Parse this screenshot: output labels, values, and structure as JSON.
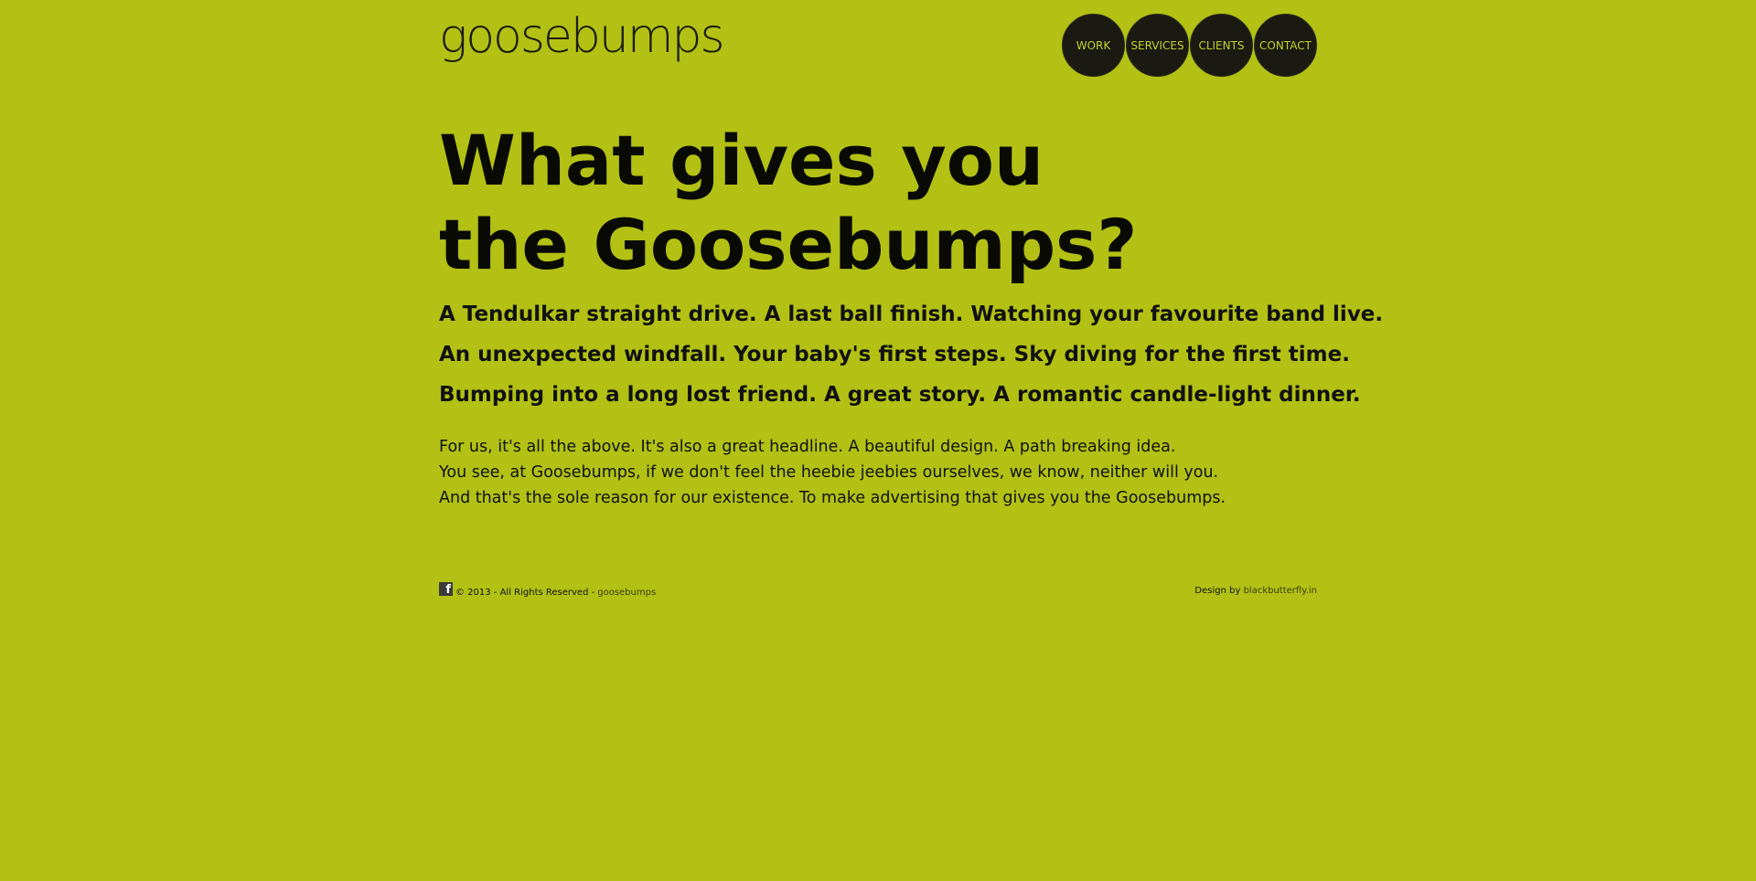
{
  "brand": {
    "logo_text": "goosebumps"
  },
  "nav": {
    "items": [
      {
        "label": "WORK"
      },
      {
        "label": "SERVICES"
      },
      {
        "label": "CLIENTS"
      },
      {
        "label": "CONTACT"
      }
    ]
  },
  "hero": {
    "headline_line1": "What gives you",
    "headline_line2": "the Goosebumps?",
    "sub_lines": [
      "A Tendulkar straight drive. A last ball finish. Watching your favourite band live.",
      "An unexpected windfall. Your baby's first steps. Sky diving for the first time.",
      "Bumping into a long lost friend. A great story. A romantic candle-light dinner."
    ],
    "body_lines": [
      "For us, it's all the above. It's also a great headline. A beautiful design. A path breaking idea.",
      "You see, at Goosebumps, if we don't feel the heebie jeebies ourselves, we know, neither will you.",
      "And that's the sole reason for our existence. To make advertising that gives you the Goosebumps."
    ]
  },
  "footer": {
    "copyright": "© 2013 - All Rights Reserved -",
    "copyright_link": "goosebumps",
    "design_by": "Design by",
    "design_link": "blackbutterfly.in",
    "facebook_icon": "facebook-icon"
  },
  "colors": {
    "background": "#b2c114",
    "nav_circle": "#1b1a12",
    "nav_text": "#c4d12a"
  }
}
